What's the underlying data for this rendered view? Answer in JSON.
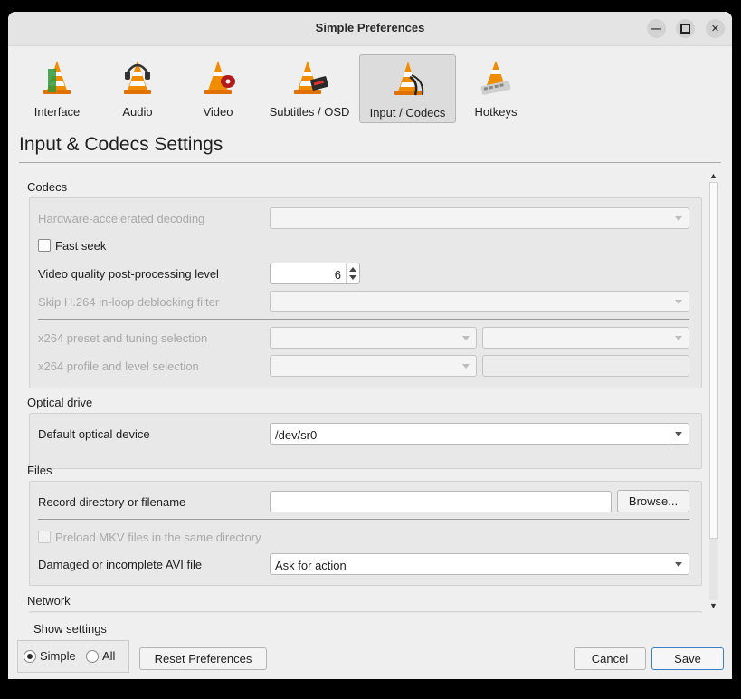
{
  "window": {
    "title": "Simple Preferences"
  },
  "tabs": [
    {
      "label": "Interface",
      "icon": "vlc-cone-interface-icon"
    },
    {
      "label": "Audio",
      "icon": "vlc-cone-headphones-icon"
    },
    {
      "label": "Video",
      "icon": "vlc-cone-film-icon"
    },
    {
      "label": "Subtitles / OSD",
      "icon": "vlc-cone-subtitles-icon"
    },
    {
      "label": "Input / Codecs",
      "icon": "vlc-cone-cables-icon",
      "active": true
    },
    {
      "label": "Hotkeys",
      "icon": "vlc-cone-keyboard-icon"
    }
  ],
  "page_heading": "Input & Codecs Settings",
  "codecs": {
    "title": "Codecs",
    "hw_decoding_label": "Hardware-accelerated decoding",
    "fast_seek_label": "Fast seek",
    "pp_level_label": "Video quality post-processing level",
    "pp_level_value": "6",
    "skip_h264_label": "Skip H.264 in-loop deblocking filter",
    "x264_preset_label": "x264 preset and tuning selection",
    "x264_profile_label": "x264 profile and level selection"
  },
  "optical": {
    "title": "Optical drive",
    "device_label": "Default optical device",
    "device_value": "/dev/sr0"
  },
  "files": {
    "title": "Files",
    "record_label": "Record directory or filename",
    "browse_label": "Browse...",
    "preload_label": "Preload MKV files in the same directory",
    "avi_label": "Damaged or incomplete AVI file",
    "avi_value": "Ask for action"
  },
  "network": {
    "title": "Network"
  },
  "footer": {
    "show_settings_label": "Show settings",
    "simple_label": "Simple",
    "all_label": "All",
    "reset_label": "Reset Preferences",
    "cancel_label": "Cancel",
    "save_label": "Save"
  }
}
